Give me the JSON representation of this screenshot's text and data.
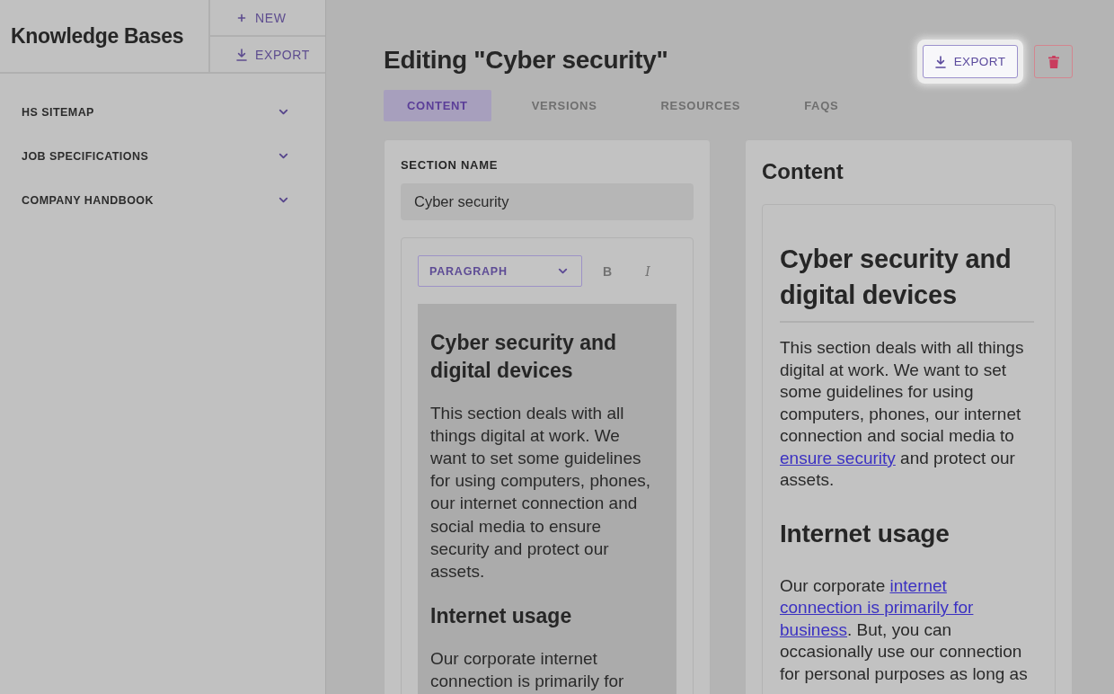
{
  "sidebar": {
    "title": "Knowledge Bases",
    "actions": [
      {
        "kind": "add",
        "label": "NEW"
      },
      {
        "kind": "export",
        "label": "EXPORT"
      }
    ],
    "items": [
      {
        "label": "HS SITEMAP",
        "expanded": false
      },
      {
        "label": "JOB SPECIFICATIONS",
        "expanded": false
      },
      {
        "label": "COMPANY HANDBOOK",
        "expanded": false
      }
    ]
  },
  "header": {
    "title": "Editing \"Cyber security\"",
    "export_button": {
      "label": "EXPORT",
      "highlighted": true
    }
  },
  "tabs": [
    {
      "label": "CONTENT",
      "selected": true
    },
    {
      "label": "VERSIONS",
      "selected": false
    },
    {
      "label": "RESOURCES",
      "selected": false
    },
    {
      "label": "FAQS",
      "selected": false
    }
  ],
  "editor": {
    "section_name": {
      "label": "SECTION NAME",
      "value": "Cyber security"
    },
    "block_format": "PARAGRAPH",
    "format_buttons": [
      {
        "kind": "bold",
        "label": "B"
      },
      {
        "kind": "italic",
        "label": "I"
      }
    ],
    "blocks": [
      {
        "kind": "heading",
        "text": "Cyber security and digital devices"
      },
      {
        "kind": "paragraph",
        "text": "This section deals with all things digital at work. We want to set some guidelines for using computers, phones, our internet connection and social media to ensure security and protect our assets."
      },
      {
        "kind": "heading",
        "text": "Internet usage"
      },
      {
        "kind": "paragraph",
        "text": "Our corporate internet connection is primarily for"
      }
    ]
  },
  "preview": {
    "title": "Content",
    "blocks": [
      {
        "kind": "title",
        "text": "Cyber security and digital devices"
      },
      {
        "kind": "paragraph",
        "parts": [
          {
            "kind": "text",
            "text": "This section deals with all things digital at work. We want to set some guidelines for using computers, phones, our internet connection and social media to "
          },
          {
            "kind": "link",
            "text": "ensure security"
          },
          {
            "kind": "text",
            "text": " and protect our assets."
          }
        ]
      },
      {
        "kind": "heading",
        "text": "Internet usage"
      },
      {
        "kind": "paragraph",
        "parts": [
          {
            "kind": "text",
            "text": "Our corporate "
          },
          {
            "kind": "link",
            "text": "internet"
          },
          {
            "kind": "link",
            "text": "connection is primarily for"
          },
          {
            "kind": "link",
            "text": "business"
          },
          {
            "kind": "text",
            "text": ". But, you can occasionally use our connection for personal purposes as long as"
          }
        ]
      }
    ]
  }
}
